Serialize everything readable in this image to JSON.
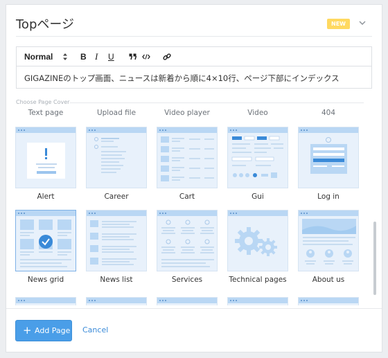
{
  "header": {
    "title": "Topページ",
    "badge": "NEW",
    "chevron_icon": "chevron-down-icon"
  },
  "editor": {
    "format_select": "Normal",
    "tools": [
      "B",
      "I",
      "U",
      "quote",
      "code",
      "link"
    ],
    "content": "GIGAZINEのトップ画面、ニュースは新着から順に4×10行、ページ下部にインデックス"
  },
  "cover": {
    "label": "Choose Page Cover",
    "partial_row": [
      "Text page",
      "Upload file",
      "Video player",
      "Video",
      "404"
    ],
    "rows": [
      [
        "Alert",
        "Career",
        "Cart",
        "Gui",
        "Log in"
      ],
      [
        "News grid",
        "News list",
        "Services",
        "Technical pages",
        "About us"
      ]
    ],
    "selected": "News grid"
  },
  "footer": {
    "add_label": "Add Page",
    "cancel_label": "Cancel"
  },
  "colors": {
    "accent": "#4a9ee8",
    "badge": "#ffd960",
    "thumb_bg": "#e8f1fb",
    "thumb_bar": "#b9d7f4"
  }
}
